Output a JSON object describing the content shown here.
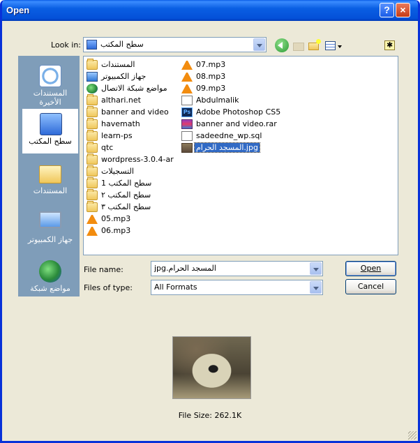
{
  "window": {
    "title": "Open",
    "help": "?",
    "close": "×"
  },
  "lookin": {
    "label": "Look in:",
    "value": "سطح المكتب"
  },
  "places": [
    {
      "label": "المستندات الأخيرة",
      "icon": "recent-documents-icon"
    },
    {
      "label": "سطح المكتب",
      "icon": "desktop-icon",
      "selected": true
    },
    {
      "label": "المستندات",
      "icon": "my-documents-icon"
    },
    {
      "label": "جهاز الكمبيوتر",
      "icon": "my-computer-icon"
    },
    {
      "label": "مواضع شبكة",
      "icon": "network-places-icon"
    }
  ],
  "files_col1": [
    {
      "name": "المستندات",
      "icon": "documents-folder-icon"
    },
    {
      "name": "جهاز الكمبيوتر",
      "icon": "computer-icon"
    },
    {
      "name": "مواضع شبكة الاتصال",
      "icon": "network-icon"
    },
    {
      "name": "althari.net",
      "icon": "folder-icon"
    },
    {
      "name": "banner and video",
      "icon": "folder-icon"
    },
    {
      "name": "havemath",
      "icon": "folder-icon"
    },
    {
      "name": "learn-ps",
      "icon": "folder-icon"
    },
    {
      "name": "qtc",
      "icon": "folder-icon"
    },
    {
      "name": "wordpress-3.0.4-ar",
      "icon": "folder-icon"
    },
    {
      "name": "التسجيلات",
      "icon": "folder-icon"
    },
    {
      "name": "سطح المكتب 1",
      "icon": "folder-icon"
    },
    {
      "name": "سطح المكتب ٢",
      "icon": "folder-icon"
    },
    {
      "name": "سطح المكتب ٣",
      "icon": "folder-icon"
    },
    {
      "name": "05.mp3",
      "icon": "vlc-icon"
    },
    {
      "name": "06.mp3",
      "icon": "vlc-icon"
    }
  ],
  "files_col2": [
    {
      "name": "07.mp3",
      "icon": "vlc-icon"
    },
    {
      "name": "08.mp3",
      "icon": "vlc-icon"
    },
    {
      "name": "09.mp3",
      "icon": "vlc-icon"
    },
    {
      "name": "Abdulmalik",
      "icon": "shortcut-icon"
    },
    {
      "name": "Adobe Photoshop CS5",
      "icon": "photoshop-icon",
      "badge": "Ps"
    },
    {
      "name": "banner and video.rar",
      "icon": "rar-icon"
    },
    {
      "name": "sadeedne_wp.sql",
      "icon": "sql-file-icon"
    },
    {
      "name": "المسجد الحرام.jpg",
      "icon": "jpg-file-icon",
      "selected": true
    }
  ],
  "filename": {
    "label": "File name:",
    "value": "المسجد الحرام.jpg"
  },
  "filetype": {
    "label": "Files of type:",
    "value": "All Formats"
  },
  "buttons": {
    "open": "Open",
    "cancel": "Cancel"
  },
  "preview": {
    "file_size": "File Size: 262.1K"
  }
}
